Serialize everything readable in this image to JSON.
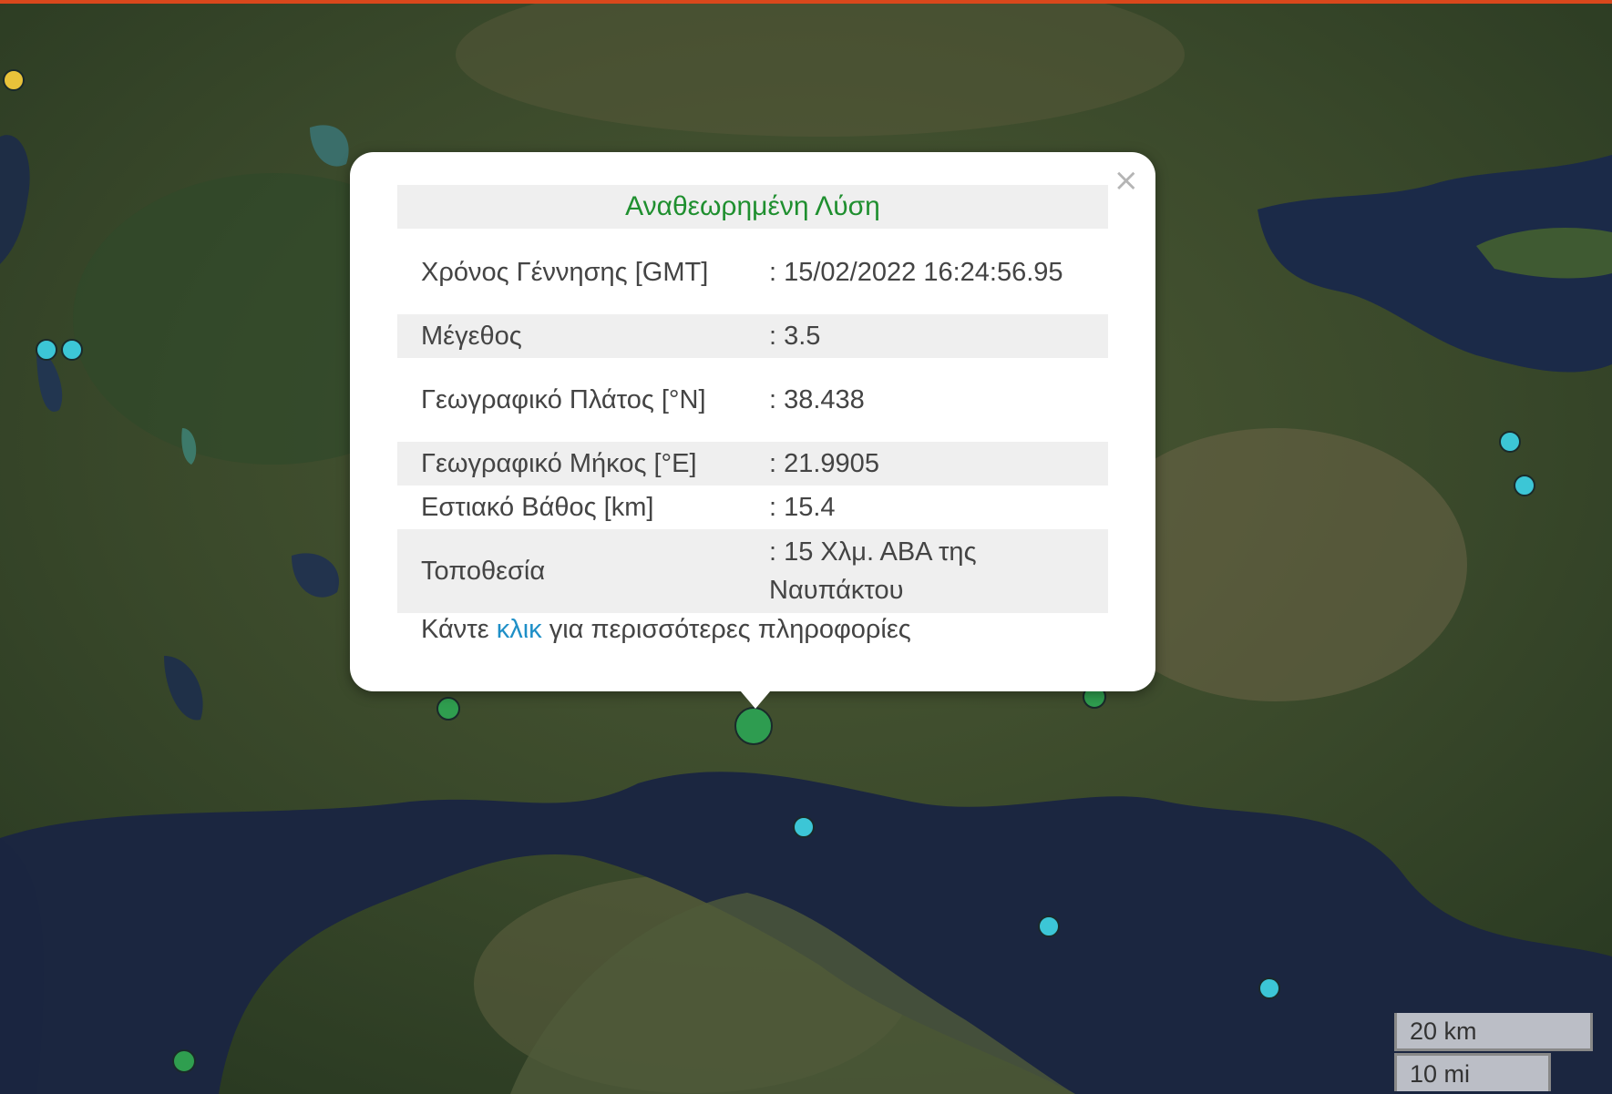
{
  "popup": {
    "title": "Αναθεωρημένη Λύση",
    "close": "×",
    "rows": [
      {
        "label": "Χρόνος Γέννησης [GMT]",
        "value": ": 15/02/2022 16:24:56.95"
      },
      {
        "label": "Μέγεθος",
        "value": ": 3.5"
      },
      {
        "label": "Γεωγραφικό Πλάτος [°N]",
        "value": ": 38.438"
      },
      {
        "label": "Γεωγραφικό Μήκος [°E]",
        "value": ": 21.9905"
      },
      {
        "label": "Εστιακό Βάθος [km]",
        "value": ": 15.4"
      },
      {
        "label": "Τοποθεσία",
        "value": ": 15 Χλμ. ΑΒΑ της Ναυπάκτου"
      }
    ],
    "more_prefix": "Κάντε ",
    "more_link": "κλικ",
    "more_suffix": " για περισσότερες πληροφορίες"
  },
  "scale": {
    "km": "20 km",
    "mi": "10 mi"
  },
  "colors": {
    "title_green": "#1f8f2f",
    "link_blue": "#1e8fc7",
    "marker_cyan": "#3cc6d6",
    "marker_green": "#2f9e4f",
    "marker_yellow": "#e8c23a"
  }
}
